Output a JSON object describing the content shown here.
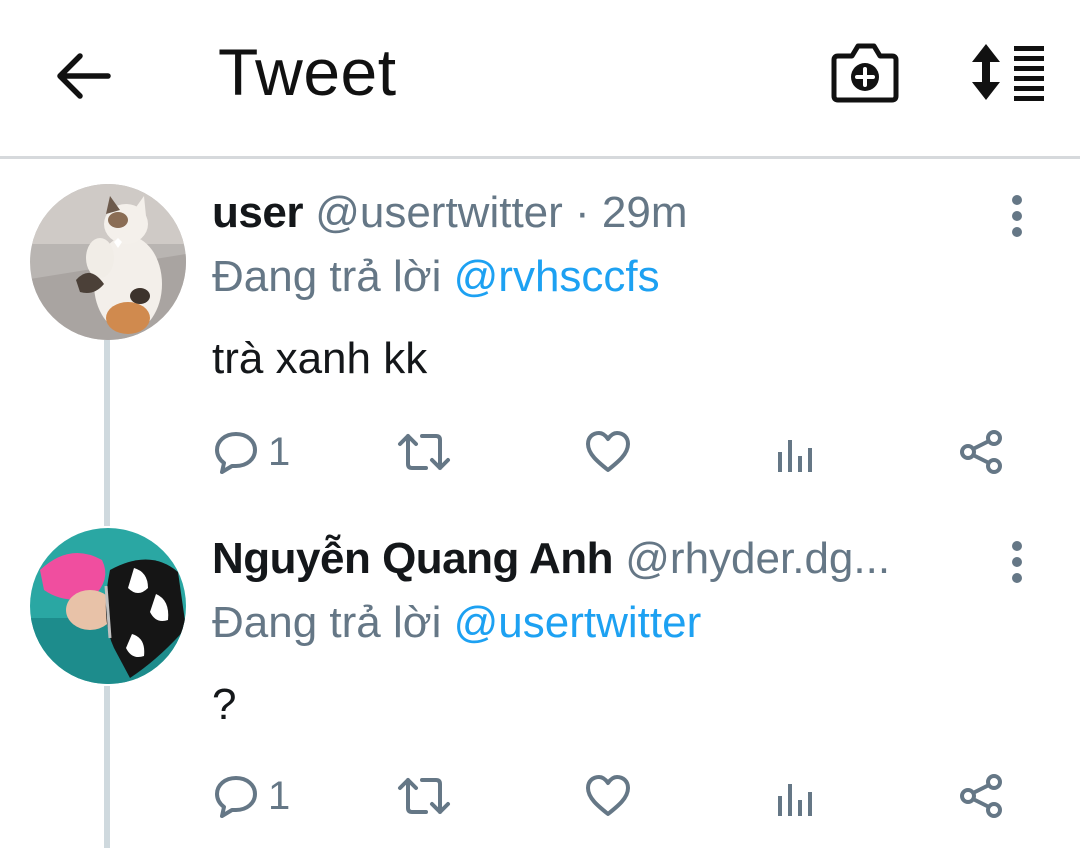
{
  "header": {
    "title": "Tweet",
    "back_icon": "arrow-left-icon",
    "camera_icon": "camera-plus-icon",
    "sort_icon": "sort-list-icon"
  },
  "tweets": [
    {
      "name": "user",
      "handle": "@usertwitter",
      "separator": " · ",
      "time": "29m",
      "reply_prefix": "Đang trả lời ",
      "reply_to": "@rvhsccfs",
      "text": "trà xanh kk",
      "reply_count": "1",
      "avatar": "cat-avatar"
    },
    {
      "name": "Nguyễn Quang Anh",
      "handle": "@rhyder.dg...",
      "reply_prefix": "Đang trả lời ",
      "reply_to": "@usertwitter",
      "text": "?",
      "reply_count": "1",
      "avatar": "person-avatar"
    }
  ],
  "colors": {
    "accent": "#1da1f2",
    "secondary_text": "#657786",
    "primary_text": "#14171a",
    "thread_line": "#cfd9de"
  }
}
